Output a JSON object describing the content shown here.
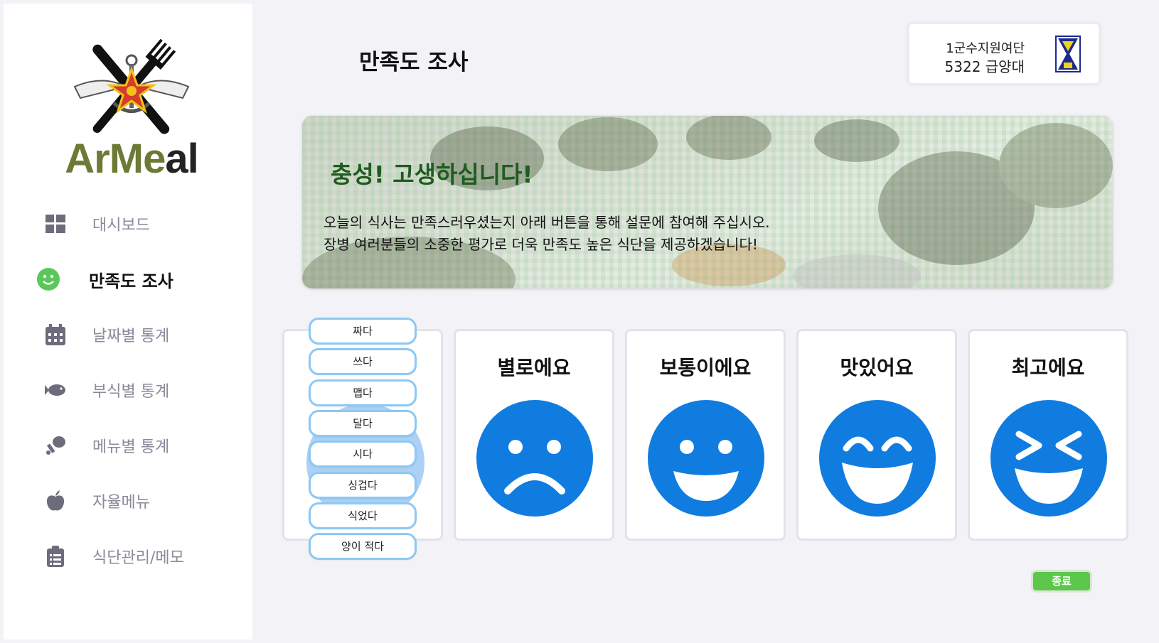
{
  "app": {
    "logo_text_part1": "Ar",
    "logo_text_part2": "Me",
    "logo_text_part3": "al"
  },
  "sidebar": {
    "items": [
      {
        "label": "대시보드",
        "icon": "grid-icon",
        "active": false
      },
      {
        "label": "만족도 조사",
        "icon": "smiley-icon",
        "active": true
      },
      {
        "label": "날짜별 통계",
        "icon": "calendar-icon",
        "active": false
      },
      {
        "label": "부식별 통계",
        "icon": "fish-icon",
        "active": false
      },
      {
        "label": "메뉴별 통계",
        "icon": "drumstick-icon",
        "active": false
      },
      {
        "label": "자율메뉴",
        "icon": "apple-icon",
        "active": false
      },
      {
        "label": "식단관리/메모",
        "icon": "clipboard-icon",
        "active": false
      }
    ]
  },
  "header": {
    "title": "만족도 조사",
    "unit_line1": "1군수지원여단",
    "unit_line2": "5322 급양대"
  },
  "banner": {
    "title": "충성! 고생하십니다!",
    "line1": "오늘의 식사는 만족스러우셨는지 아래 버튼을 통해 설문에 참여해 주십시오.",
    "line2": "장병 여러분들의 소중한 평가로 더욱 만족도 높은 식단을 제공하겠습니다!"
  },
  "ratings": [
    {
      "label": "별로에요",
      "face": "sad-face-icon"
    },
    {
      "label": "보통이에요",
      "face": "neutral-smile-face-icon"
    },
    {
      "label": "맛있어요",
      "face": "happy-face-icon"
    },
    {
      "label": "최고에요",
      "face": "laughing-face-icon"
    }
  ],
  "tags": [
    "짜다",
    "쓰다",
    "맵다",
    "달다",
    "시다",
    "싱겁다",
    "식었다",
    "양이 적다"
  ],
  "end_button": "종료",
  "colors": {
    "accent_blue": "#107ce0",
    "active_green": "#5bc75b",
    "end_green": "#5cc74a",
    "banner_title": "#1f5c1f"
  }
}
